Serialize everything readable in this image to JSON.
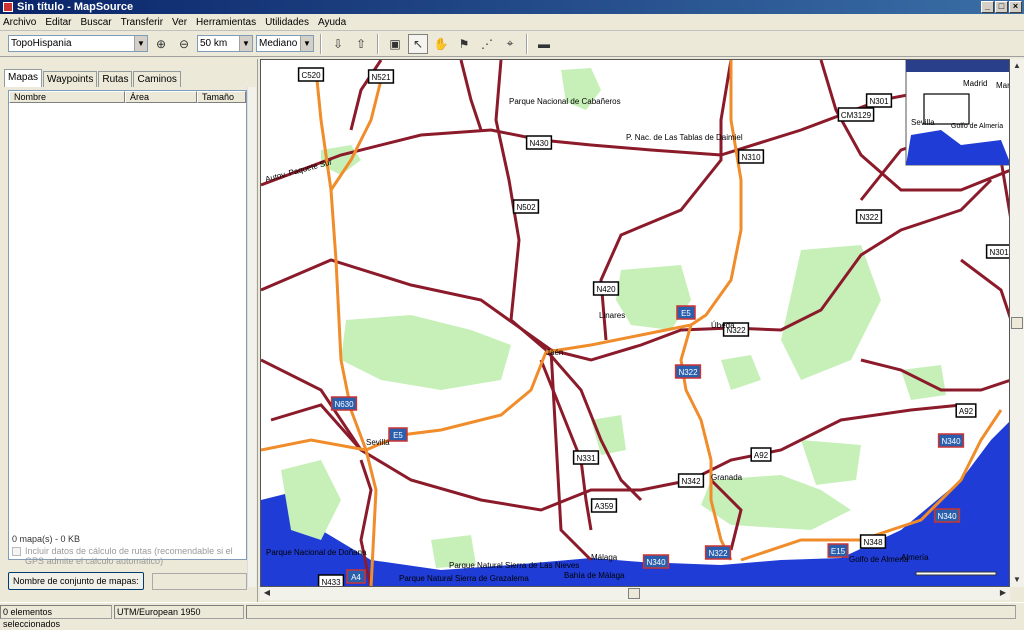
{
  "window": {
    "title": "Sin título - MapSource"
  },
  "menu": [
    "Archivo",
    "Editar",
    "Buscar",
    "Transferir",
    "Ver",
    "Herramientas",
    "Utilidades",
    "Ayuda"
  ],
  "toolbar": {
    "product": "TopoHispania",
    "zoom": "50 km",
    "detail": "Mediano"
  },
  "tabs": [
    "Mapas",
    "Waypoints",
    "Rutas",
    "Caminos"
  ],
  "columns": [
    "Nombre",
    "Área",
    "Tamaño"
  ],
  "panel": {
    "count": "0 mapa(s) - 0 KB",
    "checkbox_label": "Incluir datos de cálculo de rutas (recomendable si el GPS admite el cálculo automático)",
    "set_name_button": "Nombre de conjunto de mapas:"
  },
  "status": {
    "selection": "0 elementos seleccionados",
    "datum": "UTM/European 1950"
  },
  "map": {
    "road_labels": [
      "C520",
      "N521",
      "N301",
      "CM3129",
      "N430",
      "N310",
      "N502",
      "N322",
      "N301",
      "N420",
      "E5",
      "N322",
      "N322",
      "N630",
      "E5",
      "A92",
      "N340",
      "A92",
      "N331",
      "N342",
      "A359",
      "N340",
      "N340",
      "N322",
      "E15",
      "N348",
      "A4",
      "N433"
    ],
    "place_labels": [
      "Parque Nacional de Cabañeros",
      "P. Nac. de Las Tablas de Daimiel",
      "Autov. Paquete Sur",
      "Málaga",
      "Parque Natural Sierra de Las Nieves",
      "Bahía de Málaga",
      "Parque Nacional de Doñana",
      "Parque Natural Sierra de Grazalema",
      "Almería",
      "Golfo de Almería",
      "Jaén",
      "Úbeda",
      "Granada",
      "Sevilla",
      "Linares"
    ],
    "overview_labels": [
      "Madrid",
      "Mar",
      "Sevilla",
      "Golfo de Almería"
    ]
  },
  "colors": {
    "highway": "#f08c2a",
    "road": "#8b1a2a",
    "park": "#c7f0b9",
    "water": "#1f3dd6",
    "titlebar": "#0a246a"
  }
}
